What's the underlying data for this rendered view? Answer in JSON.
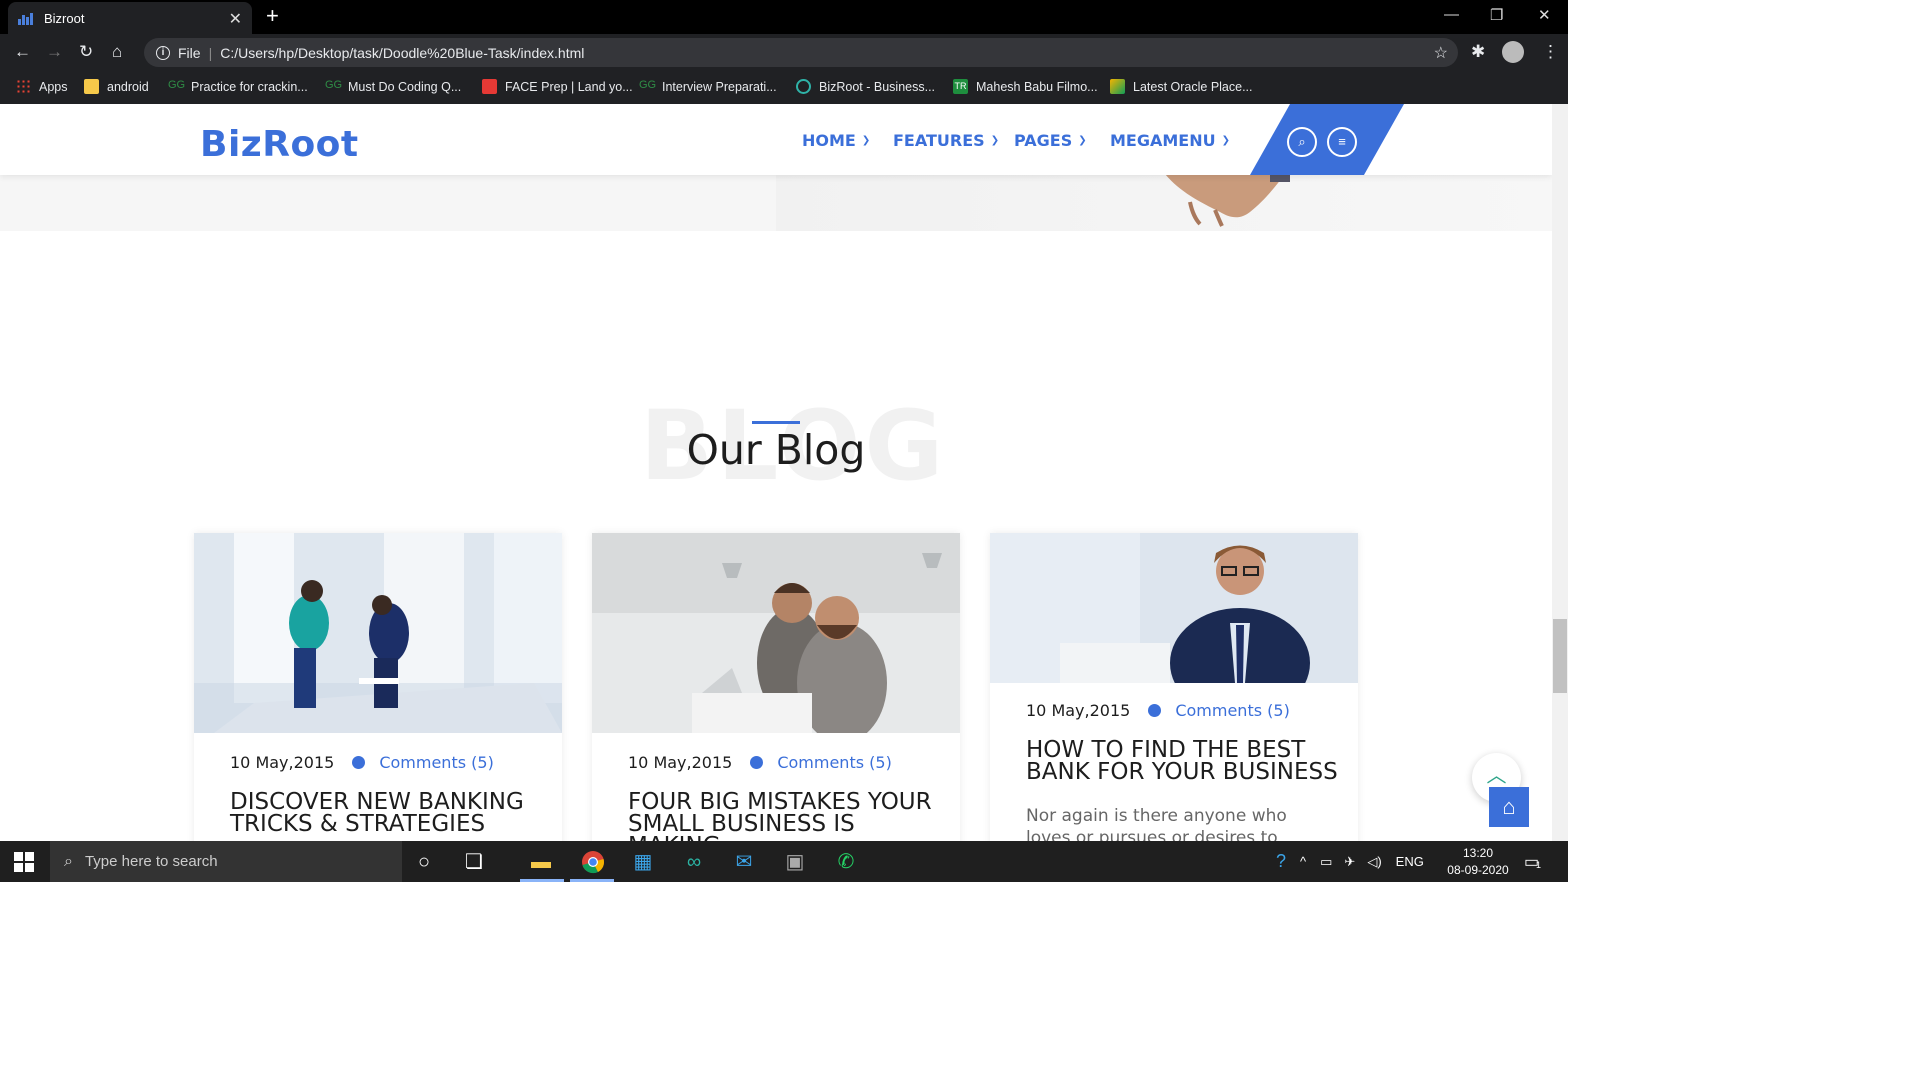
{
  "browser": {
    "tab_title": "Bizroot",
    "url_scheme_label": "File",
    "url": "C:/Users/hp/Desktop/task/Doodle%20Blue-Task/index.html",
    "bookmarks": [
      {
        "label": "Apps",
        "icon": "apps-grid-icon"
      },
      {
        "label": "android",
        "icon": "folder-icon"
      },
      {
        "label": "Practice for crackin...",
        "icon": "gfg-icon"
      },
      {
        "label": "Must Do Coding Q...",
        "icon": "gfg-icon"
      },
      {
        "label": "FACE Prep | Land yo...",
        "icon": "faceprep-icon"
      },
      {
        "label": "Interview Preparati...",
        "icon": "gfg-icon"
      },
      {
        "label": "BizRoot - Business...",
        "icon": "bizroot-icon"
      },
      {
        "label": "Mahesh Babu Filmo...",
        "icon": "tr-icon"
      },
      {
        "label": "Latest Oracle Place...",
        "icon": "oracle-icon"
      }
    ]
  },
  "site": {
    "logo": "BizRoot",
    "nav": [
      {
        "label": "HOME"
      },
      {
        "label": "FEATURES"
      },
      {
        "label": "PAGES"
      },
      {
        "label": "MEGAMENU"
      }
    ],
    "accent_color": "#3b6fd9"
  },
  "blog": {
    "bg_word": "BLOG",
    "title": "Our Blog",
    "posts": [
      {
        "date": "10 May,2015",
        "comments": "Comments (5)",
        "title": "DISCOVER NEW BANKING TRICKS & STRATEGIES"
      },
      {
        "date": "10 May,2015",
        "comments": "Comments (5)",
        "title": "FOUR BIG MISTAKES YOUR SMALL BUSINESS IS MAKING"
      },
      {
        "date": "10 May,2015",
        "comments": "Comments (5)",
        "title": "HOW TO FIND THE BEST BANK FOR YOUR BUSINESS",
        "excerpt": "Nor again is there anyone who loves or pursues or desires to obtain pain of"
      }
    ]
  },
  "taskbar": {
    "search_placeholder": "Type here to search",
    "language": "ENG",
    "time": "13:20",
    "date": "08-09-2020",
    "notification_count": "1"
  }
}
